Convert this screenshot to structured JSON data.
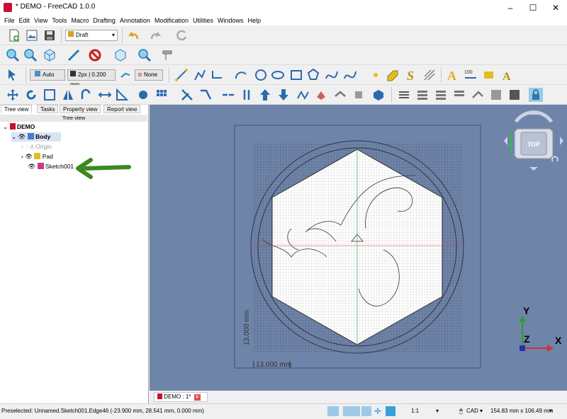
{
  "window": {
    "title": "* DEMO - FreeCAD 1.0.0",
    "minimize": "–",
    "maximize": "☐",
    "close": "✕"
  },
  "menu": [
    "File",
    "Edit",
    "View",
    "Tools",
    "Macro",
    "Drafting",
    "Annotation",
    "Modification",
    "Utilities",
    "Windows",
    "Help"
  ],
  "toolbar": {
    "workbench_combo": "Draft",
    "autogroup_label": "Auto",
    "linestyle_label": "2px | 0.200 mm",
    "construction_label": "None",
    "text_icon_100": "100"
  },
  "left_panel": {
    "tabs": [
      "Tree view",
      "Tasks",
      "Property view",
      "Report view"
    ],
    "header": "Tree view",
    "tree": [
      {
        "label": "DEMO",
        "level": 0,
        "bold": true
      },
      {
        "label": "Body",
        "level": 1,
        "bold": true
      },
      {
        "label": "Origin",
        "level": 2,
        "muted": true
      },
      {
        "label": "Pad",
        "level": 2
      },
      {
        "label": "Sketch001",
        "level": 2
      }
    ]
  },
  "view3d": {
    "navcube_face": "TOP",
    "dim_vertical": "13.000 mm",
    "dim_horizontal": "13.000 mm",
    "axis_labels": [
      "X",
      "Y",
      "Z"
    ],
    "colors": {
      "background": "#6f84a9",
      "x_axis": "#d23232",
      "y_axis": "#2aa02a",
      "z_axis": "#2c2caa",
      "arrow": "#3a8a1e"
    }
  },
  "doc_tab": {
    "label": "DEMO : 1*"
  },
  "status": {
    "message": "Preselected: Unnamed.Sketch001.Edge46 (-23.900 mm, 28.541 mm, 0.000 mm)",
    "scale": "1:1",
    "nav_style": "CAD",
    "dimensions": "154.83 mm x 106.49 mm"
  }
}
